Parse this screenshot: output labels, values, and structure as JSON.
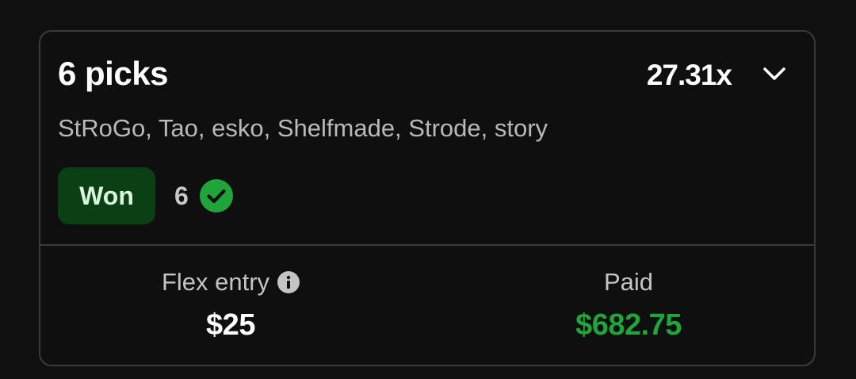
{
  "card": {
    "title": "6 picks",
    "multiplier": "27.31x",
    "players": "StRoGo, Tao, esko, Shelfmade, Strode, story",
    "status": {
      "badge": "Won",
      "correct_count": "6",
      "badge_bg": "#0b3f14",
      "check_color": "#1fa53a"
    },
    "icons": {
      "expand": "chevron-down-icon",
      "correct": "check-circle-icon",
      "info": "info-icon"
    },
    "entry": {
      "label": "Flex entry",
      "value": "$25"
    },
    "paid": {
      "label": "Paid",
      "value": "$682.75",
      "color": "#1fa53a"
    }
  }
}
